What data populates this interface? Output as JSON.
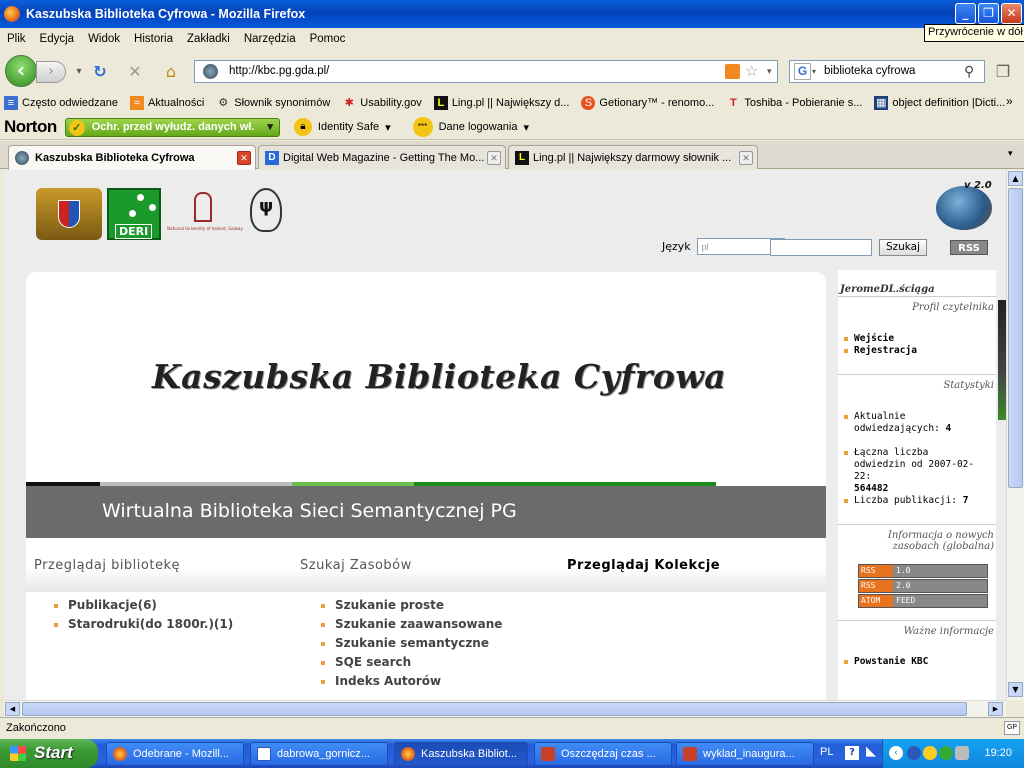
{
  "window": {
    "title": "Kaszubska Biblioteka Cyfrowa - Mozilla Firefox",
    "tooltip": "Przywrócenie w dół"
  },
  "menu": [
    "Plik",
    "Edycja",
    "Widok",
    "Historia",
    "Zakładki",
    "Narzędzia",
    "Pomoc"
  ],
  "nav": {
    "url": "http://kbc.pg.gda.pl/",
    "search_value": "biblioteka cyfrowa"
  },
  "bookmarks": [
    "Często odwiedzane",
    "Aktualności",
    "Słownik synonimów",
    "Usability.gov",
    "Ling.pl || Największy d...",
    "Getionary™ - renomo...",
    "Toshiba - Pobieranie s...",
    "object definition |Dicti..."
  ],
  "norton": {
    "brand": "Norton",
    "protect_label": "Ochr. przed wyłudz. danych wł.",
    "identity_label": "Identity Safe",
    "login_label": "Dane logowania"
  },
  "tabs": [
    {
      "label": "Kaszubska Biblioteka Cyfrowa"
    },
    {
      "label": "Digital Web Magazine - Getting The Mo..."
    },
    {
      "label": "Ling.pl || Największy darmowy słownik ..."
    }
  ],
  "page": {
    "language_label": "Język",
    "language_value": "pl",
    "search_button": "Szukaj",
    "rss_button": "RSS",
    "globe_badge": "v 2.0",
    "logo_caption": "National University of Ireland, Galway",
    "logo_deri": "DERI",
    "banner_title": "Kaszubska  Biblioteka Cyfrowa",
    "subtitle": "Wirtualna Biblioteka Sieci Semantycznej PG",
    "columns": [
      {
        "heading": "Przeglądaj bibliotekę",
        "items": [
          "Publikacje(6)",
          "Starodruki(do 1800r.)(1)"
        ]
      },
      {
        "heading": "Szukaj Zasobów",
        "items": [
          "Szukanie proste",
          "Szukanie zaawansowane",
          "Szukanie semantyczne",
          "SQE search",
          "Indeks Autorów"
        ]
      },
      {
        "heading": "Przeglądaj Kolekcje",
        "items": []
      }
    ],
    "sidebar": {
      "title": "JeromeDL.ściąga",
      "profile_heading": "Profil czytelnika",
      "login": "Wejście",
      "register": "Rejestracja",
      "stats_heading": "Statystyki",
      "current_visitors_label": "Aktualnie odwiedzających:",
      "current_visitors_value": "4",
      "total_visits_label": "Łączna liczba odwiedzin od 2007-02-22:",
      "total_visits_value": "564482",
      "publications_label": "Liczba publikacji:",
      "publications_value": "7",
      "new_resources_heading": "Informacja o nowych zasobach (globalna)",
      "feeds": [
        {
          "key": "RSS",
          "value": "1.0"
        },
        {
          "key": "RSS",
          "value": "2.0"
        },
        {
          "key": "ATOM",
          "value": "FEED"
        }
      ],
      "important_heading": "Ważne informacje",
      "news_item": "Powstanie KBC"
    }
  },
  "status": "Zakończono",
  "taskbar": {
    "start": "Start",
    "tasks": [
      "Odebrane - Mozill...",
      "dabrowa_gornicz...",
      "Kaszubska Bibliot...",
      "Oszczędzaj czas ...",
      "wyklad_inaugura..."
    ],
    "language": "PL",
    "clock": "19:20"
  }
}
